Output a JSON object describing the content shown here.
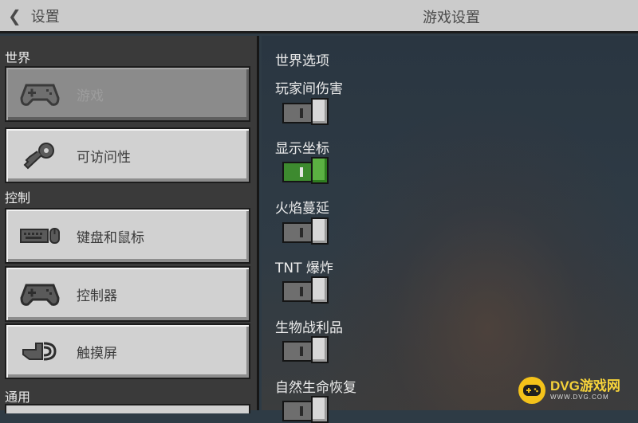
{
  "header": {
    "back_label": "设置",
    "title": "游戏设置"
  },
  "sidebar": {
    "sections": [
      {
        "label": "世界"
      },
      {
        "label": "控制"
      },
      {
        "label": "通用"
      }
    ],
    "items": [
      {
        "label": "游戏",
        "icon": "gamepad-icon",
        "selected": true
      },
      {
        "label": "可访问性",
        "icon": "key-icon",
        "selected": false
      },
      {
        "label": "键盘和鼠标",
        "icon": "keyboard-mouse-icon",
        "selected": false
      },
      {
        "label": "控制器",
        "icon": "controller-icon",
        "selected": false
      },
      {
        "label": "触摸屏",
        "icon": "touch-icon",
        "selected": false
      }
    ]
  },
  "main": {
    "section_title": "世界选项",
    "options": [
      {
        "label": "玩家间伤害",
        "enabled": false
      },
      {
        "label": "显示坐标",
        "enabled": true
      },
      {
        "label": "火焰蔓延",
        "enabled": false
      },
      {
        "label": "TNT 爆炸",
        "enabled": false
      },
      {
        "label": "生物战利品",
        "enabled": false
      },
      {
        "label": "自然生命恢复",
        "enabled": false
      }
    ]
  },
  "watermark": {
    "main": "DVG游戏网",
    "sub": "WWW.DVG.COM"
  }
}
